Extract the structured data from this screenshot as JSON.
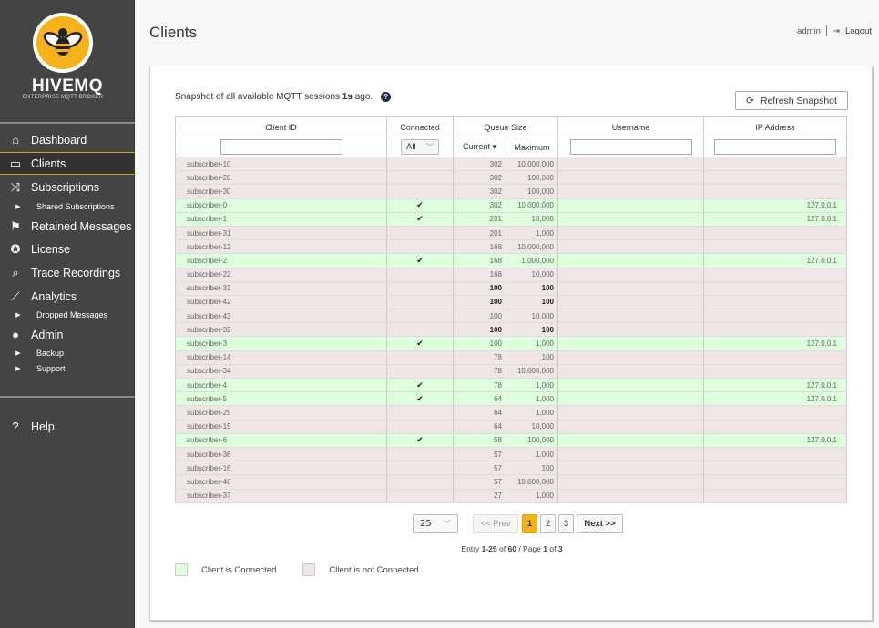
{
  "brand": {
    "name": "HIVEMQ",
    "tagline": "ENTERPRISE MQTT BROKER",
    "accent": "#f5b21b"
  },
  "sidebar": {
    "items": [
      {
        "label": "Dashboard",
        "icon": "home-icon",
        "glyph": "⌂"
      },
      {
        "label": "Clients",
        "icon": "devices-icon",
        "glyph": "▭",
        "active": true
      },
      {
        "label": "Subscriptions",
        "icon": "shuffle-icon",
        "glyph": "⤨"
      },
      {
        "label": "Shared Subscriptions",
        "sub": true
      },
      {
        "label": "Retained Messages",
        "icon": "flag-icon",
        "glyph": "⚑"
      },
      {
        "label": "License",
        "icon": "award-icon",
        "glyph": "✪"
      },
      {
        "label": "Trace Recordings",
        "icon": "laptop-search-icon",
        "glyph": "⌕"
      },
      {
        "label": "Analytics",
        "icon": "line-chart-icon",
        "glyph": "⟋"
      },
      {
        "label": "Dropped Messages",
        "sub": true
      },
      {
        "label": "Admin",
        "icon": "user-icon",
        "glyph": "●"
      },
      {
        "label": "Backup",
        "sub": true
      },
      {
        "label": "Support",
        "sub": true
      }
    ],
    "help": {
      "label": "Help",
      "glyph": "?"
    }
  },
  "header": {
    "title": "Clients",
    "user": "admin",
    "logout": "Logout"
  },
  "snapshot": {
    "prefix": "Snapshot of all available MQTT sessions",
    "age": "1s",
    "suffix": "ago."
  },
  "refresh_label": "Refresh Snapshot",
  "table": {
    "headers": {
      "client_id": "Client ID",
      "connected": "Connected",
      "connected_filter": "All",
      "queue": "Queue Size",
      "current": "Current ▾",
      "maximum": "Maximum",
      "username": "Username",
      "ip": "IP Address"
    },
    "rows": [
      {
        "id": "subscriber-10",
        "c": false,
        "cur": "302",
        "max": "10,000,000",
        "ip": ""
      },
      {
        "id": "subscriber-20",
        "c": false,
        "cur": "302",
        "max": "100,000",
        "ip": ""
      },
      {
        "id": "subscriber-30",
        "c": false,
        "cur": "302",
        "max": "100,000",
        "ip": ""
      },
      {
        "id": "subscriber-0",
        "c": true,
        "cur": "302",
        "max": "10,000,000",
        "ip": "127.0.0.1"
      },
      {
        "id": "subscriber-1",
        "c": true,
        "cur": "201",
        "max": "10,000",
        "ip": "127.0.0.1"
      },
      {
        "id": "subscriber-31",
        "c": false,
        "cur": "201",
        "max": "1,000",
        "ip": ""
      },
      {
        "id": "subscriber-12",
        "c": false,
        "cur": "168",
        "max": "10,000,000",
        "ip": ""
      },
      {
        "id": "subscriber-2",
        "c": true,
        "cur": "168",
        "max": "1,000,000",
        "ip": "127.0.0.1"
      },
      {
        "id": "subscriber-22",
        "c": false,
        "cur": "168",
        "max": "10,000",
        "ip": ""
      },
      {
        "id": "subscriber-33",
        "c": false,
        "cur": "100",
        "max": "100",
        "ip": "",
        "full": true
      },
      {
        "id": "subscriber-42",
        "c": false,
        "cur": "100",
        "max": "100",
        "ip": "",
        "full": true
      },
      {
        "id": "subscriber-43",
        "c": false,
        "cur": "100",
        "max": "10,000",
        "ip": ""
      },
      {
        "id": "subscriber-32",
        "c": false,
        "cur": "100",
        "max": "100",
        "ip": "",
        "full": true
      },
      {
        "id": "subscriber-3",
        "c": true,
        "cur": "100",
        "max": "1,000",
        "ip": "127.0.0.1"
      },
      {
        "id": "subscriber-14",
        "c": false,
        "cur": "78",
        "max": "100",
        "ip": ""
      },
      {
        "id": "subscriber-34",
        "c": false,
        "cur": "78",
        "max": "10,000,000",
        "ip": ""
      },
      {
        "id": "subscriber-4",
        "c": true,
        "cur": "78",
        "max": "1,000",
        "ip": "127.0.0.1"
      },
      {
        "id": "subscriber-5",
        "c": true,
        "cur": "64",
        "max": "1,000",
        "ip": "127.0.0.1"
      },
      {
        "id": "subscriber-25",
        "c": false,
        "cur": "64",
        "max": "1,000",
        "ip": ""
      },
      {
        "id": "subscriber-15",
        "c": false,
        "cur": "64",
        "max": "10,000",
        "ip": ""
      },
      {
        "id": "subscriber-6",
        "c": true,
        "cur": "58",
        "max": "100,000",
        "ip": "127.0.0.1"
      },
      {
        "id": "subscriber-36",
        "c": false,
        "cur": "57",
        "max": "1,000",
        "ip": ""
      },
      {
        "id": "subscriber-16",
        "c": false,
        "cur": "57",
        "max": "100",
        "ip": ""
      },
      {
        "id": "subscriber-46",
        "c": false,
        "cur": "57",
        "max": "10,000,000",
        "ip": ""
      },
      {
        "id": "subscriber-37",
        "c": false,
        "cur": "27",
        "max": "1,000",
        "ip": ""
      }
    ],
    "check_glyph": "✔"
  },
  "pagination": {
    "page_size": "25",
    "prev": "<< Prev",
    "next": "Next >>",
    "pages": [
      "1",
      "2",
      "3"
    ],
    "current_page": "1",
    "entry": {
      "prefix": "Entry",
      "range": "1-25",
      "of": "of",
      "total": "60",
      "page_word": "/ Page",
      "page": "1",
      "of2": "of",
      "pages": "3"
    }
  },
  "legend": {
    "connected": "Client is Connected",
    "not_connected": "Client is not Connected",
    "connected_color": "#ddffdd",
    "not_connected_color": "#f1e6e6"
  }
}
